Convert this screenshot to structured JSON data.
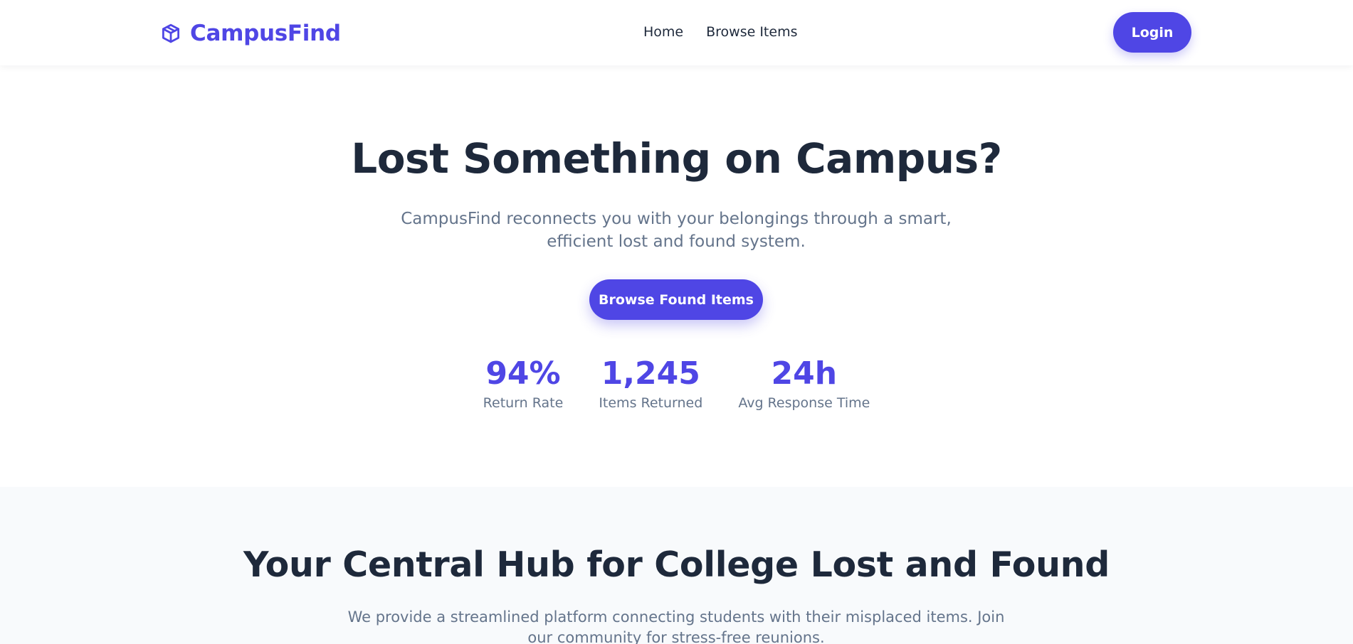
{
  "header": {
    "brand": "CampusFind",
    "nav": [
      {
        "label": "Home"
      },
      {
        "label": "Browse Items"
      }
    ],
    "login_label": "Login"
  },
  "hero": {
    "title": "Lost Something on Campus?",
    "subtitle": "CampusFind reconnects you with your belongings through a smart, efficient lost and found system.",
    "cta_label": "Browse Found Items",
    "stats": [
      {
        "value": "94%",
        "label": "Return Rate"
      },
      {
        "value": "1,245",
        "label": "Items Returned"
      },
      {
        "value": "24h",
        "label": "Avg Response Time"
      }
    ]
  },
  "about": {
    "title": "Your Central Hub for College Lost and Found",
    "text": "We provide a streamlined platform connecting students with their misplaced items. Join our community for stress-free reunions."
  },
  "icons": {
    "brand_icon": "cube-icon"
  },
  "colors": {
    "accent": "#4f46e5",
    "heading": "#1e293b",
    "muted": "#64748b",
    "section_bg": "#f8fafc"
  }
}
